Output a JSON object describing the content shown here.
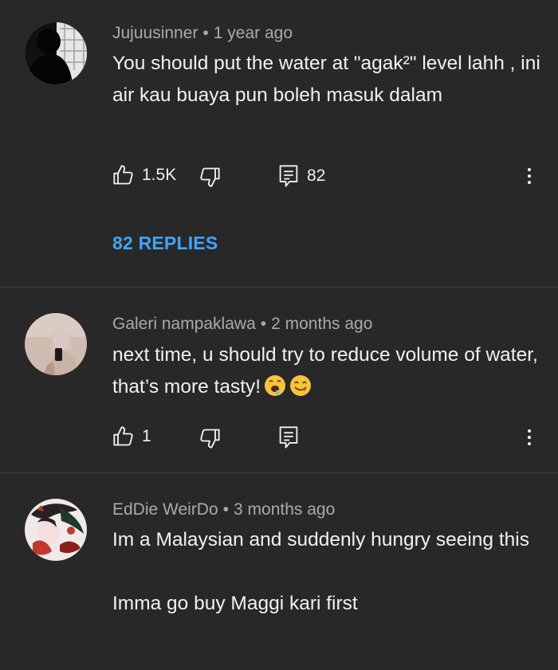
{
  "comments": [
    {
      "author": "Jujuusinner",
      "time": "1 year ago",
      "text_lines": [
        "You should put the water at \"agak²\" level lahh , ini air kau buaya pun boleh masuk dalam"
      ],
      "likes": "1.5K",
      "reply_count": "82",
      "replies_label": "82 REPLIES",
      "avatar_icon": "silhouette-avatar"
    },
    {
      "author": "Galeri nampaklawa",
      "time": "2 months ago",
      "text_lines": [
        "next time, u should try to reduce volume of water, that’s more tasty!"
      ],
      "likes": "1",
      "emojis": [
        "drooling-face-emoji",
        "yum-face-emoji"
      ],
      "avatar_icon": "girl-selfie-avatar"
    },
    {
      "author": "EdDie WeirDo",
      "time": "3 months ago",
      "text_lines": [
        "Im a Malaysian and suddenly hungry seeing this",
        "Imma go buy Maggi kari first"
      ],
      "avatar_icon": "anime-art-avatar"
    }
  ],
  "separator": "•",
  "colors": {
    "background": "#282828",
    "primary_text": "#f1f1f1",
    "secondary_text": "#aaaaaa",
    "link_blue": "#3ea6ff",
    "divider": "#3d3d3d"
  }
}
